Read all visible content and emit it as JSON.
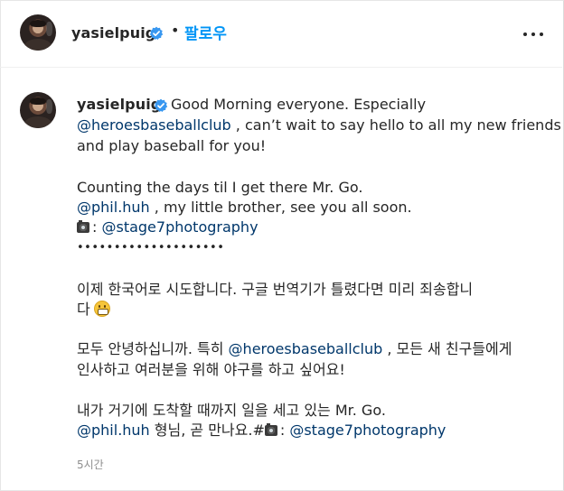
{
  "header": {
    "username": "yasielpuig",
    "separator": "•",
    "follow_label": "팔로우",
    "more_icon": "more-horizontal-icon",
    "verified_icon": "verified-badge-icon"
  },
  "post": {
    "username": "yasielpuig",
    "line1_text": "Good Morning everyone. Especially",
    "line2_mention": "@heroesbaseballclub",
    "line2_text": " , can’t wait to say hello to all my new friends",
    "line3_text": "and play baseball for you!",
    "line4_text": "Counting the days til I get there Mr. Go.",
    "line5_mention": "@phil.huh",
    "line5_text": " , my little brother, see you all soon.",
    "line6_prefix": ": ",
    "line6_mention": "@stage7photography",
    "line7_text": "••••••••••••••••••••",
    "line8_text": "이제 한국어로 시도합니다. 구글 번역기가 틀렸다면 미리 죄송합니",
    "line9_text": "다",
    "line10_text": "모두 안녕하십니까. 특히 ",
    "line10_mention": "@heroesbaseballclub",
    "line10_text2": " , 모든 새 친구들에게",
    "line11_text": "인사하고 여러분을 위해 야구를 하고 싶어요!",
    "line12_text": "내가 거기에 도착할 때까지 일을 세고 있는 Mr. Go.",
    "line13_mention": "@phil.huh",
    "line13_text": " 형님, 곧 만나요.#",
    "line13_prefix2": ": ",
    "line13_mention2": "@stage7photography",
    "emoji_icon": "grimacing-face-icon",
    "camera_icon": "camera-icon",
    "timestamp": "5시간"
  },
  "colors": {
    "link": "#00376b",
    "follow": "#0095f6",
    "verified": "#3897f0",
    "timestamp": "#8e8e8e"
  }
}
